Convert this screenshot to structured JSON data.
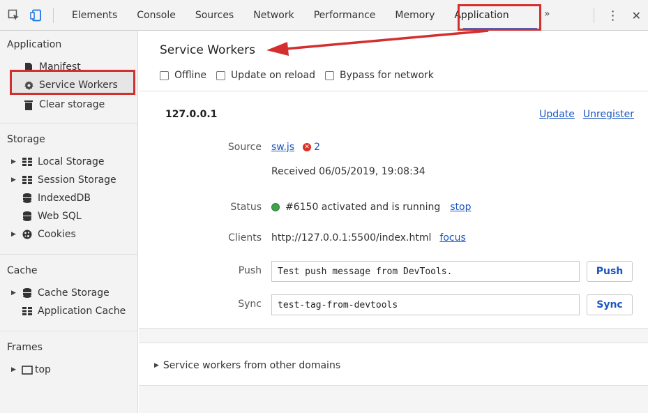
{
  "tabs": {
    "items": [
      "Elements",
      "Console",
      "Sources",
      "Network",
      "Performance",
      "Memory",
      "Application"
    ],
    "active": "Application",
    "overflow": "»",
    "more": "⋮",
    "close": "✕"
  },
  "sidebar": {
    "application_title": "Application",
    "application_items": [
      "Manifest",
      "Service Workers",
      "Clear storage"
    ],
    "storage_title": "Storage",
    "storage_items": [
      "Local Storage",
      "Session Storage",
      "IndexedDB",
      "Web SQL",
      "Cookies"
    ],
    "cache_title": "Cache",
    "cache_items": [
      "Cache Storage",
      "Application Cache"
    ],
    "frames_title": "Frames",
    "frames_items": [
      "top"
    ]
  },
  "main": {
    "title": "Service Workers",
    "checkboxes": [
      "Offline",
      "Update on reload",
      "Bypass for network"
    ],
    "host": "127.0.0.1",
    "update_link": "Update",
    "unregister_link": "Unregister",
    "source_label": "Source",
    "source_file": "sw.js",
    "error_count": "2",
    "received": "Received 06/05/2019, 19:08:34",
    "status_label": "Status",
    "status_text": "#6150 activated and is running",
    "stop_link": "stop",
    "clients_label": "Clients",
    "clients_url": "http://127.0.0.1:5500/index.html",
    "focus_link": "focus",
    "push_label": "Push",
    "push_value": "Test push message from DevTools.",
    "push_button": "Push",
    "sync_label": "Sync",
    "sync_value": "test-tag-from-devtools",
    "sync_button": "Sync",
    "other_domains": "Service workers from other domains"
  },
  "colors": {
    "highlight_red": "#d32f2f",
    "link_blue": "#1a55c0",
    "status_green": "#3fa34d",
    "error_red": "#d93025"
  }
}
